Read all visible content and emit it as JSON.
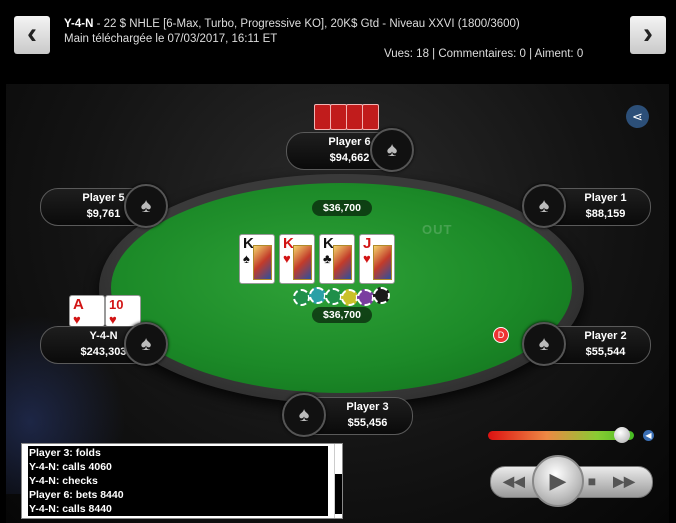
{
  "header": {
    "title_bold": "Y-4-N",
    "title_rest": " - 22 $ NHLE [6-Max, Turbo, Progressive KO], 20K$ Gtd - Niveau XXVI (1800/3600)",
    "subtitle": "Main téléchargée le 07/03/2017, 16:11 ET",
    "stats": "Vues: 18 | Commentaires: 0 | Aiment: 0",
    "prev_icon": "‹",
    "next_icon": "›"
  },
  "table": {
    "felt_logo": "OUT",
    "pot_top": "$36,700",
    "pot_bottom": "$36,700",
    "dealer_label": "D"
  },
  "players": [
    {
      "name": "Player 6",
      "stack": "$94,662"
    },
    {
      "name": "Player 5",
      "stack": "$9,761"
    },
    {
      "name": "Player 1",
      "stack": "$88,159"
    },
    {
      "name": "Y-4-N",
      "stack": "$243,303"
    },
    {
      "name": "Player 2",
      "stack": "$55,544"
    },
    {
      "name": "Player 3",
      "stack": "$55,456"
    }
  ],
  "board": [
    {
      "rank": "K",
      "suit": "♠",
      "color": "black"
    },
    {
      "rank": "K",
      "suit": "♥",
      "color": "red"
    },
    {
      "rank": "K",
      "suit": "♣",
      "color": "black"
    },
    {
      "rank": "J",
      "suit": "♥",
      "color": "red"
    }
  ],
  "hero_cards": [
    {
      "rank": "A",
      "suit": "♥"
    },
    {
      "rank": "10",
      "suit": "♥"
    }
  ],
  "log": [
    "Player 3: folds",
    "Y-4-N: calls 4060",
    "Y-4-N: checks",
    "Player 6: bets 8440",
    "Y-4-N: calls 8440"
  ],
  "controls": {
    "rewind": "◀◀",
    "play": "▶",
    "stop": "■",
    "forward": "▶▶",
    "volume_icon": "◀",
    "volume_level": 0.92
  },
  "colors": {
    "felt": "#1c8a28",
    "card_red": "#d21414",
    "share": "#2c4f78"
  }
}
